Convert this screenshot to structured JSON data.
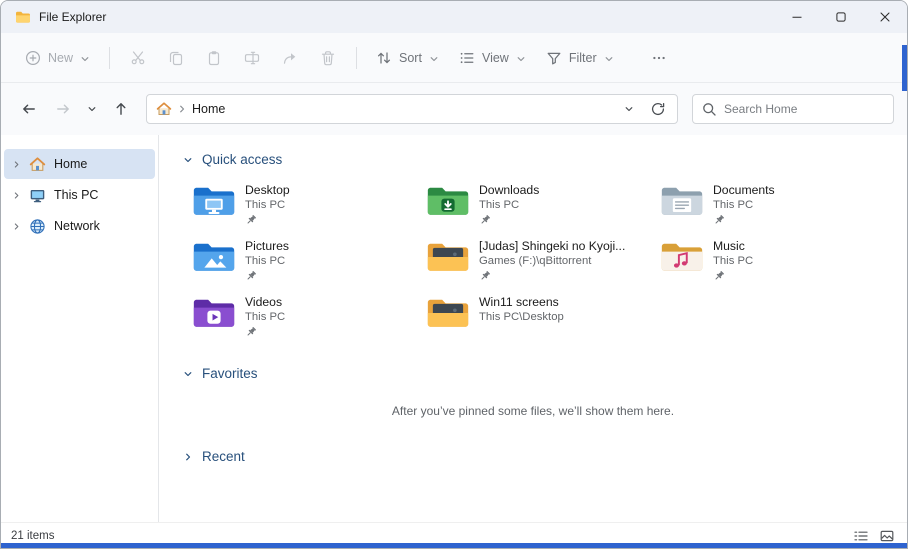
{
  "window": {
    "title": "File Explorer"
  },
  "toolbar": {
    "new_label": "New",
    "sort_label": "Sort",
    "view_label": "View",
    "filter_label": "Filter",
    "disabled_actions": [
      "cut",
      "copy",
      "paste",
      "rename",
      "share",
      "delete"
    ]
  },
  "navbar": {
    "breadcrumb_root": "Home",
    "search_placeholder": "Search Home"
  },
  "sidebar": {
    "items": [
      {
        "label": "Home",
        "icon": "home",
        "selected": true
      },
      {
        "label": "This PC",
        "icon": "this-pc",
        "selected": false
      },
      {
        "label": "Network",
        "icon": "network",
        "selected": false
      }
    ]
  },
  "content": {
    "quick_access": {
      "title": "Quick access",
      "expanded": true
    },
    "favorites": {
      "title": "Favorites",
      "expanded": true,
      "empty_message": "After you’ve pinned some files, we’ll show them here."
    },
    "recent": {
      "title": "Recent",
      "expanded": false
    },
    "quick_access_items": [
      {
        "name": "Desktop",
        "location": "This PC",
        "pinned": true,
        "icon": "desktop"
      },
      {
        "name": "Downloads",
        "location": "This PC",
        "pinned": true,
        "icon": "downloads"
      },
      {
        "name": "Documents",
        "location": "This PC",
        "pinned": true,
        "icon": "documents"
      },
      {
        "name": "Pictures",
        "location": "This PC",
        "pinned": true,
        "icon": "pictures"
      },
      {
        "name": "[Judas] Shingeki no Kyoji...",
        "location": "Games (F:)\\qBittorrent",
        "pinned": true,
        "icon": "media-folder"
      },
      {
        "name": "Music",
        "location": "This PC",
        "pinned": true,
        "icon": "music"
      },
      {
        "name": "Videos",
        "location": "This PC",
        "pinned": true,
        "icon": "videos"
      },
      {
        "name": "Win11 screens",
        "location": "This PC\\Desktop",
        "pinned": false,
        "icon": "media-folder"
      }
    ]
  },
  "statusbar": {
    "items_count": "21 items"
  },
  "colors": {
    "accent": "#2e63cf",
    "selection": "#d7e3f3"
  }
}
